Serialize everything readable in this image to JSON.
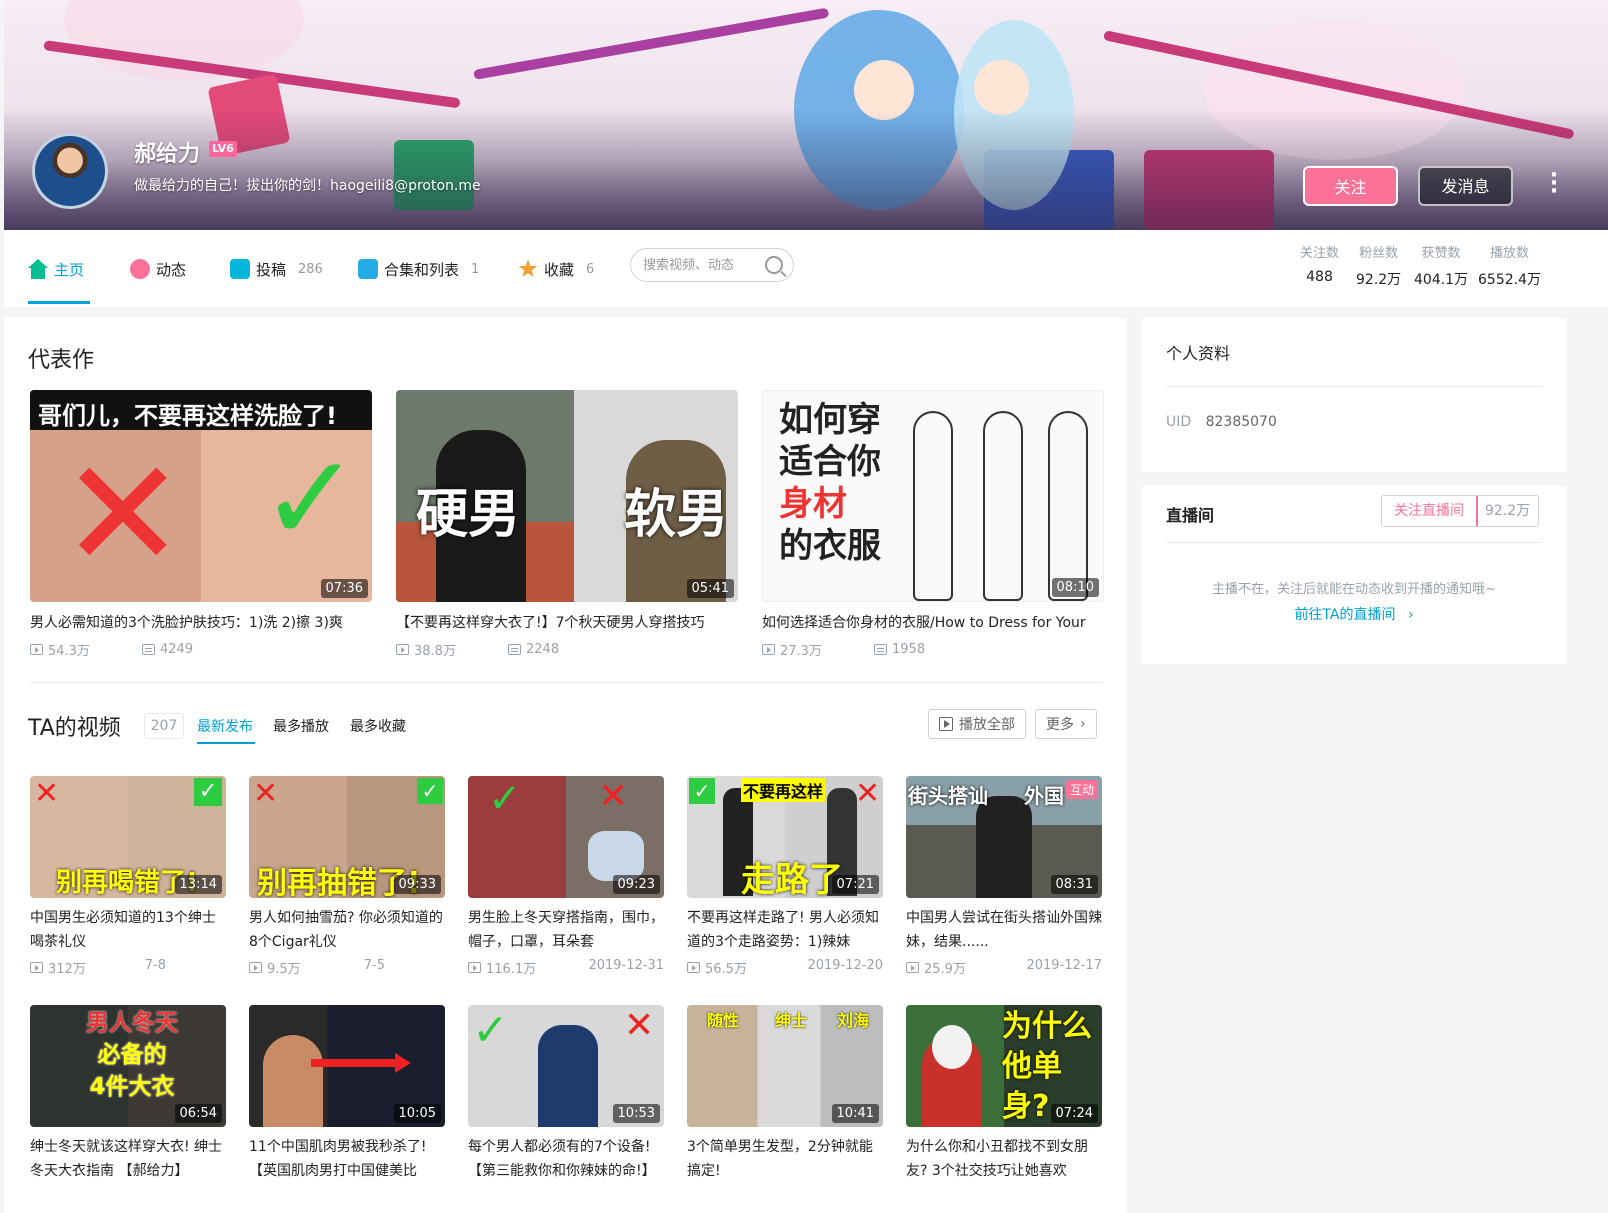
{
  "profile": {
    "name": "郝给力",
    "level": "LV6",
    "sign": "做最给力的自己！拔出你的剑！haogeili8@proton.me",
    "follow_label": "关注",
    "message_label": "发消息",
    "accent": "#fb7299"
  },
  "nav": {
    "items": [
      {
        "label": "主页",
        "count": ""
      },
      {
        "label": "动态",
        "count": ""
      },
      {
        "label": "投稿",
        "count": "286"
      },
      {
        "label": "合集和列表",
        "count": "1"
      },
      {
        "label": "收藏",
        "count": "6"
      }
    ],
    "search_placeholder": "搜索视频、动态",
    "stats": [
      {
        "label": "关注数",
        "value": "488"
      },
      {
        "label": "粉丝数",
        "value": "92.2万"
      },
      {
        "label": "获赞数",
        "value": "404.1万"
      },
      {
        "label": "播放数",
        "value": "6552.4万"
      }
    ]
  },
  "representative": {
    "title": "代表作",
    "items": [
      {
        "caption": "哥们儿，不要再这样洗脸了!",
        "duration": "07:36",
        "title": "男人必需知道的3个洗脸护肤技巧：1)洗 2)擦 3)爽",
        "plays": "54.3万",
        "danmaku": "4249"
      },
      {
        "caption": "硬男 软男",
        "duration": "05:41",
        "title": "【不要再这样穿大衣了!】7个秋天硬男人穿搭技巧",
        "plays": "38.8万",
        "danmaku": "2248"
      },
      {
        "caption": "如何穿适合你身材的衣服",
        "duration": "08:10",
        "title": "如何选择适合你身材的衣服/How to Dress for Your",
        "plays": "27.3万",
        "danmaku": "1958"
      }
    ]
  },
  "videos": {
    "title": "TA的视频",
    "count": "207",
    "tabs": [
      "最新发布",
      "最多播放",
      "最多收藏"
    ],
    "play_all_label": "播放全部",
    "more_label": "更多",
    "items": [
      {
        "caption": "别再喝错了!",
        "duration": "13:14",
        "title": "中国男生必须知道的13个绅士喝茶礼仪",
        "plays": "312万",
        "date": "7-8",
        "badge": ""
      },
      {
        "caption": "别再抽错了!",
        "duration": "09:33",
        "title": "男人如何抽雪茄? 你必须知道的8个Cigar礼仪",
        "plays": "9.5万",
        "date": "7-5",
        "badge": ""
      },
      {
        "caption": "",
        "duration": "09:23",
        "title": "男生脸上冬天穿搭指南，围巾，帽子，口罩，耳朵套",
        "plays": "116.1万",
        "date": "2019-12-31",
        "badge": ""
      },
      {
        "caption": "不要再这样 走路了",
        "duration": "07:21",
        "title": "不要再这样走路了! 男人必须知道的3个走路姿势：1)辣妹",
        "plays": "56.5万",
        "date": "2019-12-20",
        "badge": ""
      },
      {
        "caption": "街头搭讪 外国",
        "duration": "08:31",
        "title": "中国男人尝试在街头搭讪外国辣妹，结果......",
        "plays": "25.9万",
        "date": "2019-12-17",
        "badge": "互动"
      },
      {
        "caption": "男人冬天 必备的 4件大衣",
        "duration": "06:54",
        "title": "绅士冬天就该这样穿大衣! 绅士冬天大衣指南 【郝给力】",
        "plays": "",
        "date": "",
        "badge": ""
      },
      {
        "caption": "",
        "duration": "10:05",
        "title": "11个中国肌肉男被我秒杀了! 【英国肌肉男打中国健美比",
        "plays": "",
        "date": "",
        "badge": ""
      },
      {
        "caption": "",
        "duration": "10:53",
        "title": "每个男人都必须有的7个设备! 【第三能救你和你辣妹的命!】",
        "plays": "",
        "date": "",
        "badge": ""
      },
      {
        "caption": "随性 绅士 刘海",
        "duration": "10:41",
        "title": "3个简单男生发型，2分钟就能搞定!",
        "plays": "",
        "date": "",
        "badge": ""
      },
      {
        "caption": "为什么 他单身?",
        "duration": "07:24",
        "title": "为什么你和小丑都找不到女朋友? 3个社交技巧让她喜欢",
        "plays": "",
        "date": "",
        "badge": ""
      }
    ]
  },
  "side": {
    "info_title": "个人资料",
    "uid_label": "UID",
    "uid": "82385070",
    "live_title": "直播间",
    "live_follow_label": "关注直播间",
    "live_fans": "92.2万",
    "live_notice": "主播不在，关注后就能在动态收到开播的通知哦~",
    "live_link": "前往TA的直播间"
  }
}
